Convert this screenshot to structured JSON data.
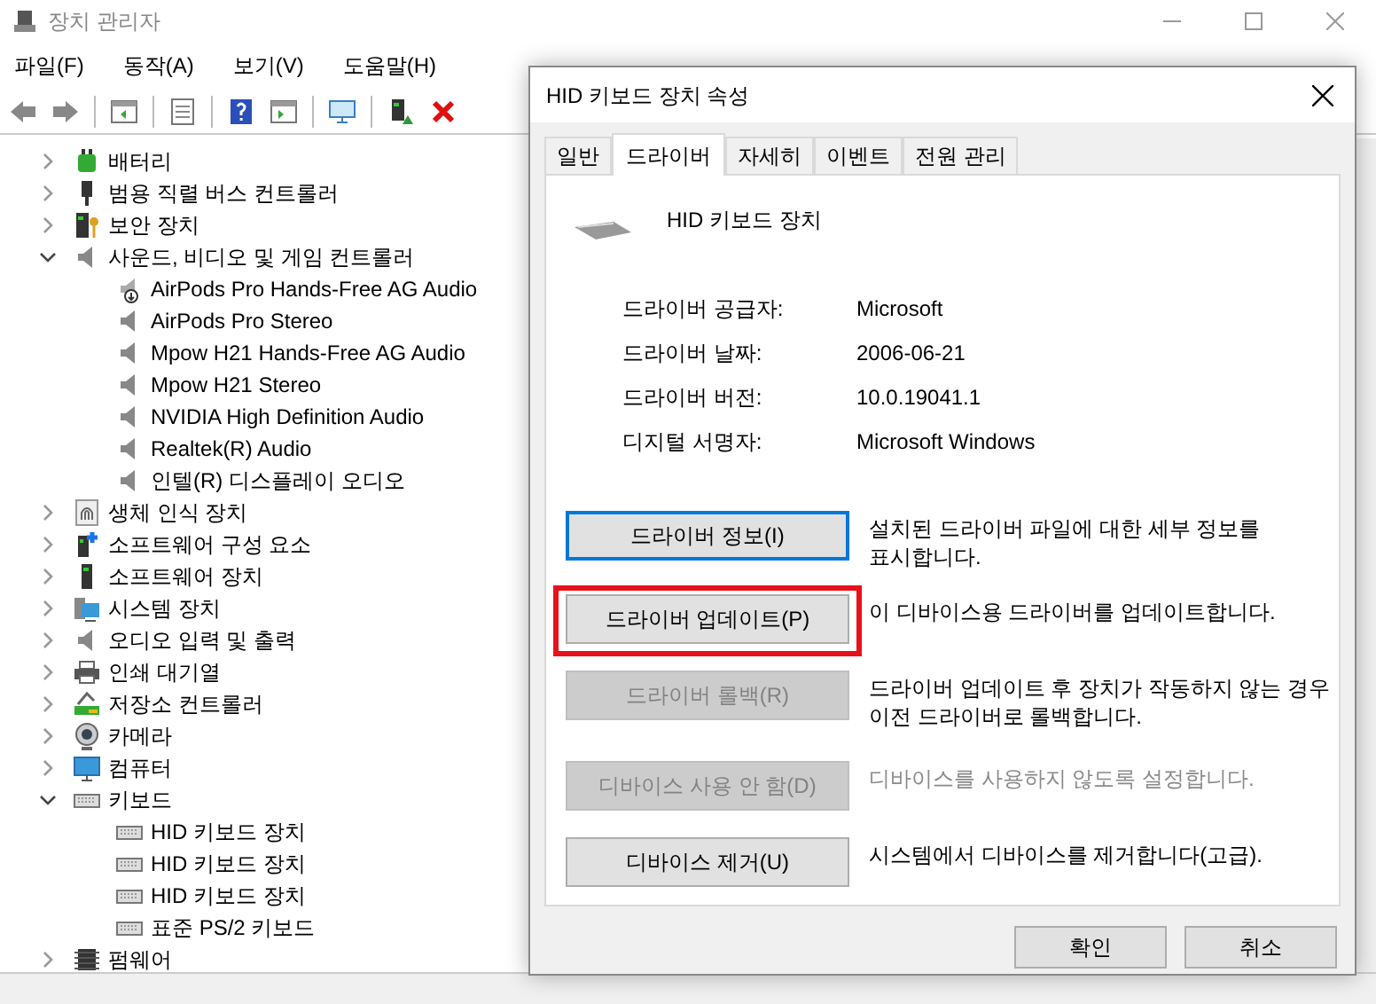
{
  "window": {
    "title": "장치 관리자"
  },
  "menu": [
    "파일(F)",
    "동작(A)",
    "보기(V)",
    "도움말(H)"
  ],
  "toolbar": [
    {
      "kind": "back"
    },
    {
      "kind": "forward"
    },
    {
      "kind": "sep"
    },
    {
      "kind": "pane"
    },
    {
      "kind": "sep"
    },
    {
      "kind": "properties"
    },
    {
      "kind": "sep"
    },
    {
      "kind": "help"
    },
    {
      "kind": "pane2"
    },
    {
      "kind": "sep"
    },
    {
      "kind": "monitor"
    },
    {
      "kind": "sep"
    },
    {
      "kind": "update"
    },
    {
      "kind": "remove"
    }
  ],
  "tree": [
    {
      "label": "배터리",
      "kind": "battery",
      "expanded": false
    },
    {
      "label": "범용 직렬 버스 컨트롤러",
      "kind": "usb",
      "expanded": false
    },
    {
      "label": "보안 장치",
      "kind": "security",
      "expanded": false
    },
    {
      "label": "사운드, 비디오 및 게임 컨트롤러",
      "kind": "speaker",
      "expanded": true,
      "children": [
        {
          "label": "AirPods Pro Hands-Free AG Audio",
          "kind": "speaker-down"
        },
        {
          "label": "AirPods Pro Stereo",
          "kind": "speaker"
        },
        {
          "label": "Mpow H21 Hands-Free AG Audio",
          "kind": "speaker"
        },
        {
          "label": "Mpow H21 Stereo",
          "kind": "speaker"
        },
        {
          "label": "NVIDIA High Definition Audio",
          "kind": "speaker"
        },
        {
          "label": "Realtek(R) Audio",
          "kind": "speaker"
        },
        {
          "label": "인텔(R) 디스플레이 오디오",
          "kind": "speaker"
        }
      ]
    },
    {
      "label": "생체 인식 장치",
      "kind": "fingerprint",
      "expanded": false
    },
    {
      "label": "소프트웨어 구성 요소",
      "kind": "component",
      "expanded": false
    },
    {
      "label": "소프트웨어 장치",
      "kind": "tower",
      "expanded": false
    },
    {
      "label": "시스템 장치",
      "kind": "system",
      "expanded": false
    },
    {
      "label": "오디오 입력 및 출력",
      "kind": "speaker",
      "expanded": false
    },
    {
      "label": "인쇄 대기열",
      "kind": "printer",
      "expanded": false
    },
    {
      "label": "저장소 컨트롤러",
      "kind": "storage",
      "expanded": false
    },
    {
      "label": "카메라",
      "kind": "camera",
      "expanded": false
    },
    {
      "label": "컴퓨터",
      "kind": "monitor",
      "expanded": false
    },
    {
      "label": "키보드",
      "kind": "keyboard",
      "expanded": true,
      "children": [
        {
          "label": "HID 키보드 장치",
          "kind": "keyboard"
        },
        {
          "label": "HID 키보드 장치",
          "kind": "keyboard"
        },
        {
          "label": "HID 키보드 장치",
          "kind": "keyboard"
        },
        {
          "label": "표준 PS/2 키보드",
          "kind": "keyboard"
        }
      ]
    },
    {
      "label": "펌웨어",
      "kind": "chip",
      "expanded": false
    }
  ],
  "dialog": {
    "title": "HID 키보드 장치 속성",
    "tabs": [
      {
        "label": "일반",
        "selected": false
      },
      {
        "label": "드라이버",
        "selected": true
      },
      {
        "label": "자세히",
        "selected": false
      },
      {
        "label": "이벤트",
        "selected": false
      },
      {
        "label": "전원 관리",
        "selected": false
      }
    ],
    "device_name": "HID 키보드 장치",
    "properties": [
      {
        "label": "드라이버 공급자:",
        "value": "Microsoft"
      },
      {
        "label": "드라이버 날짜:",
        "value": "2006-06-21"
      },
      {
        "label": "드라이버 버전:",
        "value": "10.0.19041.1"
      },
      {
        "label": "디지털 서명자:",
        "value": "Microsoft Windows"
      }
    ],
    "actions": [
      {
        "label": "드라이버 정보(I)",
        "description": "설치된 드라이버 파일에 대한 세부 정보를 표시합니다.",
        "disabled": false,
        "focused": true,
        "highlighted": false,
        "description_greyed": false
      },
      {
        "label": "드라이버 업데이트(P)",
        "description": "이 디바이스용 드라이버를 업데이트합니다.",
        "disabled": false,
        "focused": false,
        "highlighted": true,
        "description_greyed": false
      },
      {
        "label": "드라이버 롤백(R)",
        "description": "드라이버 업데이트 후 장치가 작동하지 않는 경우 이전 드라이버로 롤백합니다.",
        "disabled": true,
        "focused": false,
        "highlighted": false,
        "description_greyed": false
      },
      {
        "label": "디바이스 사용 안 함(D)",
        "description": "디바이스를 사용하지 않도록 설정합니다.",
        "disabled": true,
        "focused": false,
        "highlighted": false,
        "description_greyed": true
      },
      {
        "label": "디바이스 제거(U)",
        "description": "시스템에서 디바이스를 제거합니다(고급).",
        "disabled": false,
        "focused": false,
        "highlighted": false,
        "description_greyed": false
      }
    ],
    "buttons": [
      "확인",
      "취소"
    ]
  }
}
